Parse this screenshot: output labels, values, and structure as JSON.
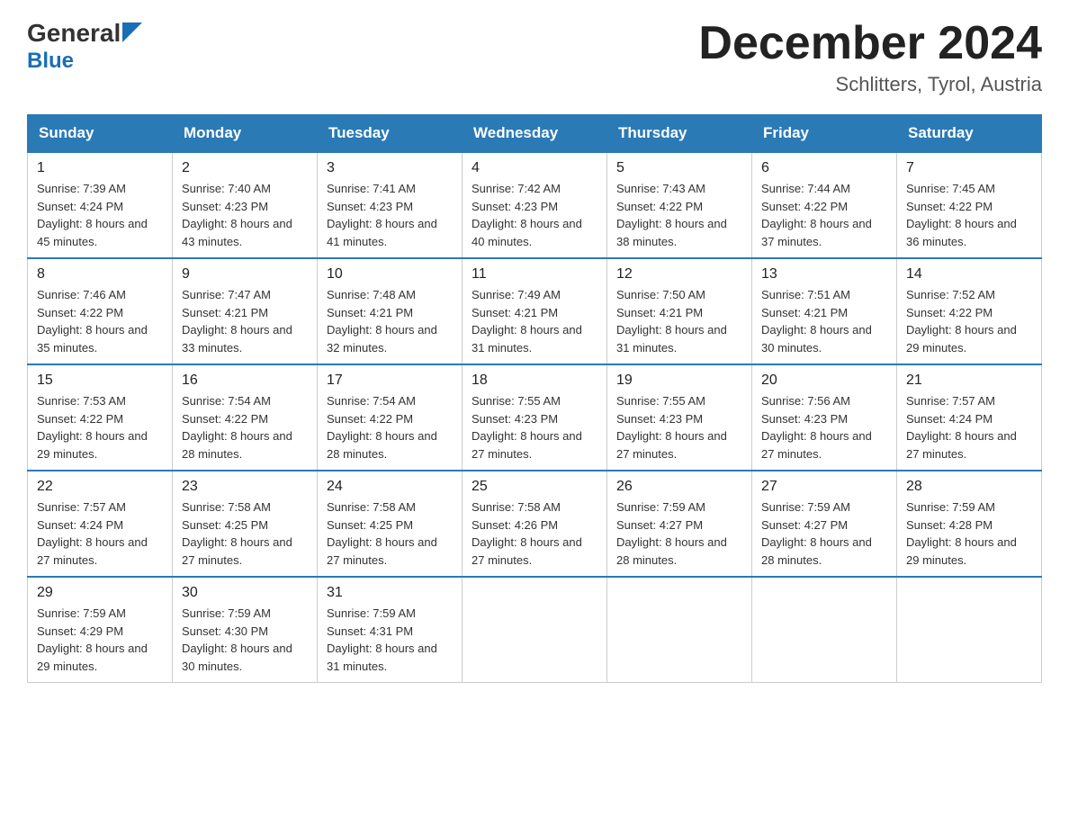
{
  "header": {
    "logo_general": "General",
    "logo_blue": "Blue",
    "month_title": "December 2024",
    "location": "Schlitters, Tyrol, Austria"
  },
  "calendar": {
    "days_of_week": [
      "Sunday",
      "Monday",
      "Tuesday",
      "Wednesday",
      "Thursday",
      "Friday",
      "Saturday"
    ],
    "weeks": [
      [
        {
          "day": "1",
          "sunrise": "7:39 AM",
          "sunset": "4:24 PM",
          "daylight": "8 hours and 45 minutes."
        },
        {
          "day": "2",
          "sunrise": "7:40 AM",
          "sunset": "4:23 PM",
          "daylight": "8 hours and 43 minutes."
        },
        {
          "day": "3",
          "sunrise": "7:41 AM",
          "sunset": "4:23 PM",
          "daylight": "8 hours and 41 minutes."
        },
        {
          "day": "4",
          "sunrise": "7:42 AM",
          "sunset": "4:23 PM",
          "daylight": "8 hours and 40 minutes."
        },
        {
          "day": "5",
          "sunrise": "7:43 AM",
          "sunset": "4:22 PM",
          "daylight": "8 hours and 38 minutes."
        },
        {
          "day": "6",
          "sunrise": "7:44 AM",
          "sunset": "4:22 PM",
          "daylight": "8 hours and 37 minutes."
        },
        {
          "day": "7",
          "sunrise": "7:45 AM",
          "sunset": "4:22 PM",
          "daylight": "8 hours and 36 minutes."
        }
      ],
      [
        {
          "day": "8",
          "sunrise": "7:46 AM",
          "sunset": "4:22 PM",
          "daylight": "8 hours and 35 minutes."
        },
        {
          "day": "9",
          "sunrise": "7:47 AM",
          "sunset": "4:21 PM",
          "daylight": "8 hours and 33 minutes."
        },
        {
          "day": "10",
          "sunrise": "7:48 AM",
          "sunset": "4:21 PM",
          "daylight": "8 hours and 32 minutes."
        },
        {
          "day": "11",
          "sunrise": "7:49 AM",
          "sunset": "4:21 PM",
          "daylight": "8 hours and 31 minutes."
        },
        {
          "day": "12",
          "sunrise": "7:50 AM",
          "sunset": "4:21 PM",
          "daylight": "8 hours and 31 minutes."
        },
        {
          "day": "13",
          "sunrise": "7:51 AM",
          "sunset": "4:21 PM",
          "daylight": "8 hours and 30 minutes."
        },
        {
          "day": "14",
          "sunrise": "7:52 AM",
          "sunset": "4:22 PM",
          "daylight": "8 hours and 29 minutes."
        }
      ],
      [
        {
          "day": "15",
          "sunrise": "7:53 AM",
          "sunset": "4:22 PM",
          "daylight": "8 hours and 29 minutes."
        },
        {
          "day": "16",
          "sunrise": "7:54 AM",
          "sunset": "4:22 PM",
          "daylight": "8 hours and 28 minutes."
        },
        {
          "day": "17",
          "sunrise": "7:54 AM",
          "sunset": "4:22 PM",
          "daylight": "8 hours and 28 minutes."
        },
        {
          "day": "18",
          "sunrise": "7:55 AM",
          "sunset": "4:23 PM",
          "daylight": "8 hours and 27 minutes."
        },
        {
          "day": "19",
          "sunrise": "7:55 AM",
          "sunset": "4:23 PM",
          "daylight": "8 hours and 27 minutes."
        },
        {
          "day": "20",
          "sunrise": "7:56 AM",
          "sunset": "4:23 PM",
          "daylight": "8 hours and 27 minutes."
        },
        {
          "day": "21",
          "sunrise": "7:57 AM",
          "sunset": "4:24 PM",
          "daylight": "8 hours and 27 minutes."
        }
      ],
      [
        {
          "day": "22",
          "sunrise": "7:57 AM",
          "sunset": "4:24 PM",
          "daylight": "8 hours and 27 minutes."
        },
        {
          "day": "23",
          "sunrise": "7:58 AM",
          "sunset": "4:25 PM",
          "daylight": "8 hours and 27 minutes."
        },
        {
          "day": "24",
          "sunrise": "7:58 AM",
          "sunset": "4:25 PM",
          "daylight": "8 hours and 27 minutes."
        },
        {
          "day": "25",
          "sunrise": "7:58 AM",
          "sunset": "4:26 PM",
          "daylight": "8 hours and 27 minutes."
        },
        {
          "day": "26",
          "sunrise": "7:59 AM",
          "sunset": "4:27 PM",
          "daylight": "8 hours and 28 minutes."
        },
        {
          "day": "27",
          "sunrise": "7:59 AM",
          "sunset": "4:27 PM",
          "daylight": "8 hours and 28 minutes."
        },
        {
          "day": "28",
          "sunrise": "7:59 AM",
          "sunset": "4:28 PM",
          "daylight": "8 hours and 29 minutes."
        }
      ],
      [
        {
          "day": "29",
          "sunrise": "7:59 AM",
          "sunset": "4:29 PM",
          "daylight": "8 hours and 29 minutes."
        },
        {
          "day": "30",
          "sunrise": "7:59 AM",
          "sunset": "4:30 PM",
          "daylight": "8 hours and 30 minutes."
        },
        {
          "day": "31",
          "sunrise": "7:59 AM",
          "sunset": "4:31 PM",
          "daylight": "8 hours and 31 minutes."
        },
        null,
        null,
        null,
        null
      ]
    ]
  }
}
